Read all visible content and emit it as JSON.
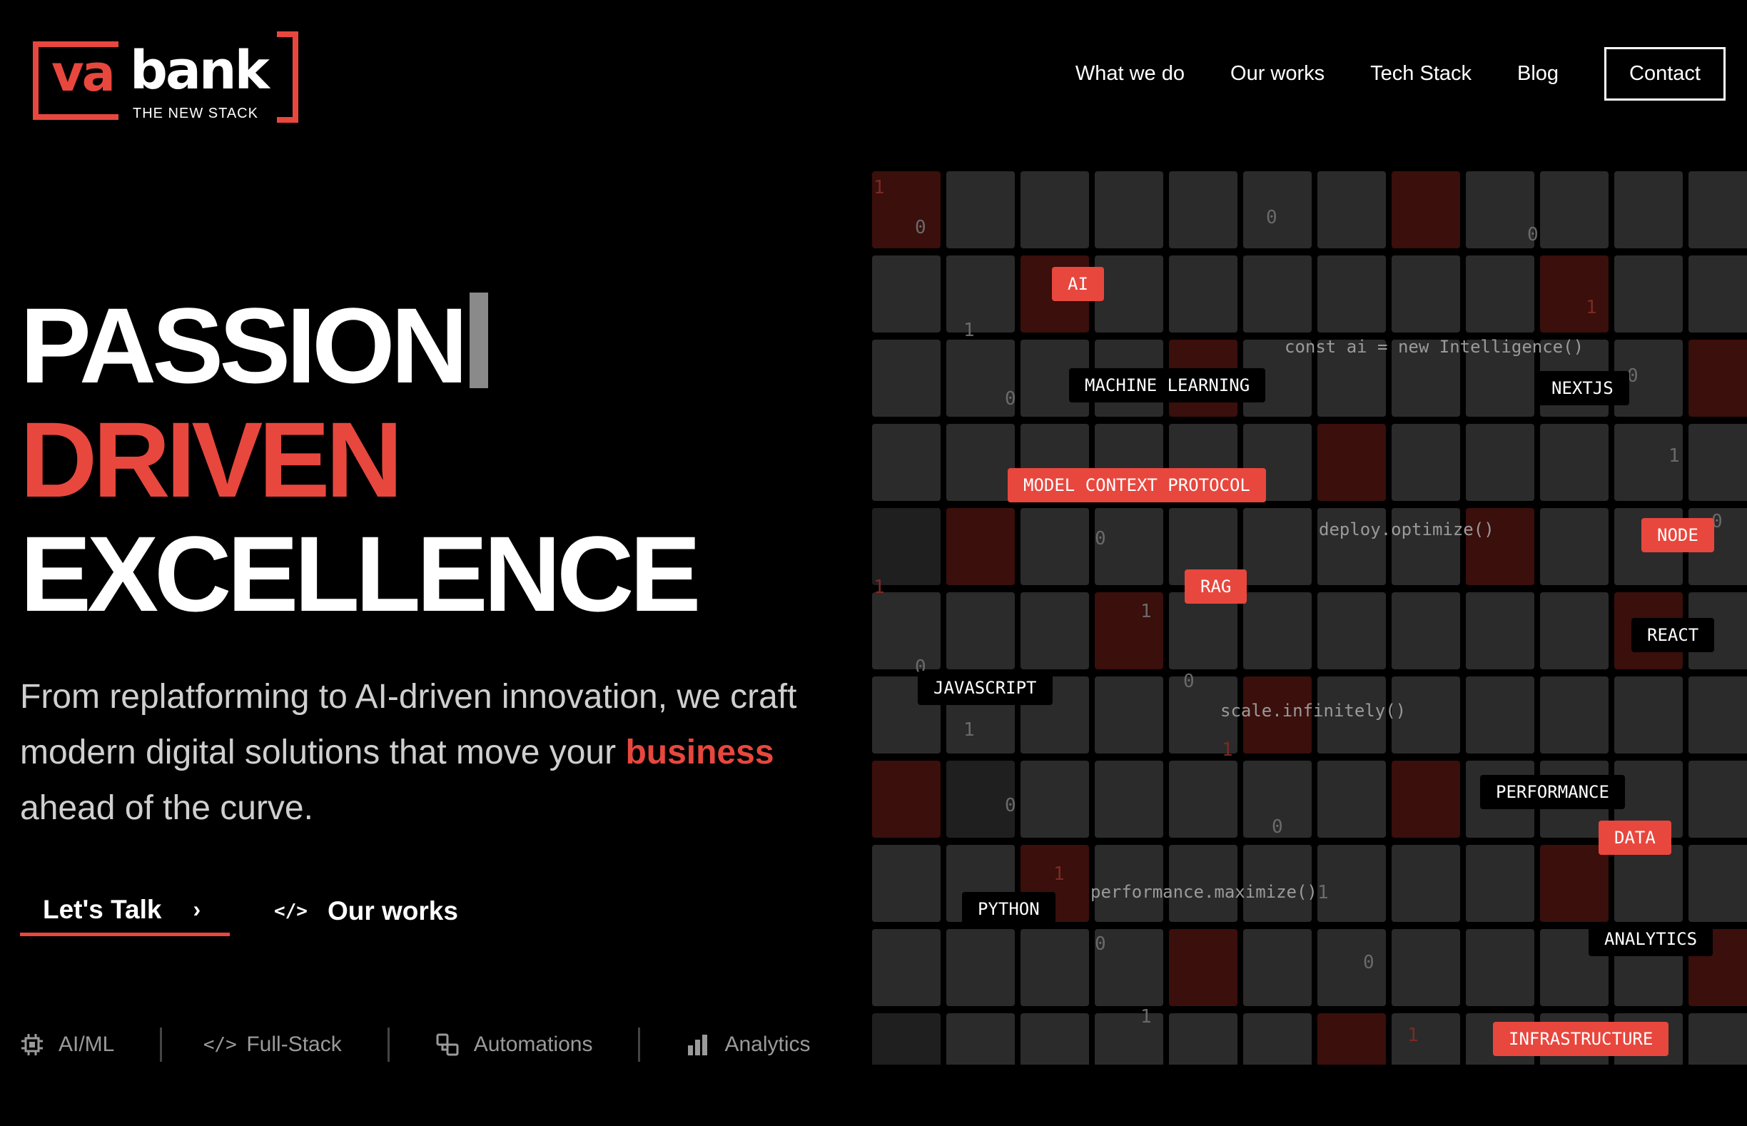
{
  "brand": {
    "name_part1": "va",
    "name_part2": "bank",
    "tagline": "THE NEW STACK",
    "accent": "#e8473e"
  },
  "nav": {
    "items": [
      "What we do",
      "Our works",
      "Tech Stack",
      "Blog"
    ],
    "contact": "Contact"
  },
  "hero": {
    "line1": "PASSION",
    "line2": "DRIVEN",
    "line3": "EXCELLENCE",
    "sub_part1": "From replatforming to AI-driven innovation, we craft modern digital solutions that move your ",
    "sub_highlight": "business",
    "sub_part2": " ahead of the curve.",
    "cta_primary": "Let's Talk",
    "cta_secondary": "Our works"
  },
  "capabilities": [
    {
      "label": "AI/ML",
      "icon": "chip-icon"
    },
    {
      "label": "Full-Stack",
      "icon": "code-icon"
    },
    {
      "label": "Automations",
      "icon": "automation-icon"
    },
    {
      "label": "Analytics",
      "icon": "bar-chart-icon"
    }
  ],
  "grid": {
    "tags": [
      {
        "text": "AI",
        "style": "red"
      },
      {
        "text": "MACHINE LEARNING",
        "style": "dark"
      },
      {
        "text": "NEXTJS",
        "style": "dark"
      },
      {
        "text": "MODEL CONTEXT PROTOCOL",
        "style": "red"
      },
      {
        "text": "NODE",
        "style": "red"
      },
      {
        "text": "RAG",
        "style": "red"
      },
      {
        "text": "REACT",
        "style": "dark"
      },
      {
        "text": "JAVASCRIPT",
        "style": "dark"
      },
      {
        "text": "PERFORMANCE",
        "style": "dark"
      },
      {
        "text": "DATA",
        "style": "red"
      },
      {
        "text": "PYTHON",
        "style": "dark"
      },
      {
        "text": "ANALYTICS",
        "style": "dark"
      },
      {
        "text": "INFRASTRUCTURE",
        "style": "red"
      }
    ],
    "snippets": [
      "const ai = new Intelligence()",
      "deploy.optimize()",
      "scale.infinitely()",
      "performance.maximize()"
    ]
  }
}
